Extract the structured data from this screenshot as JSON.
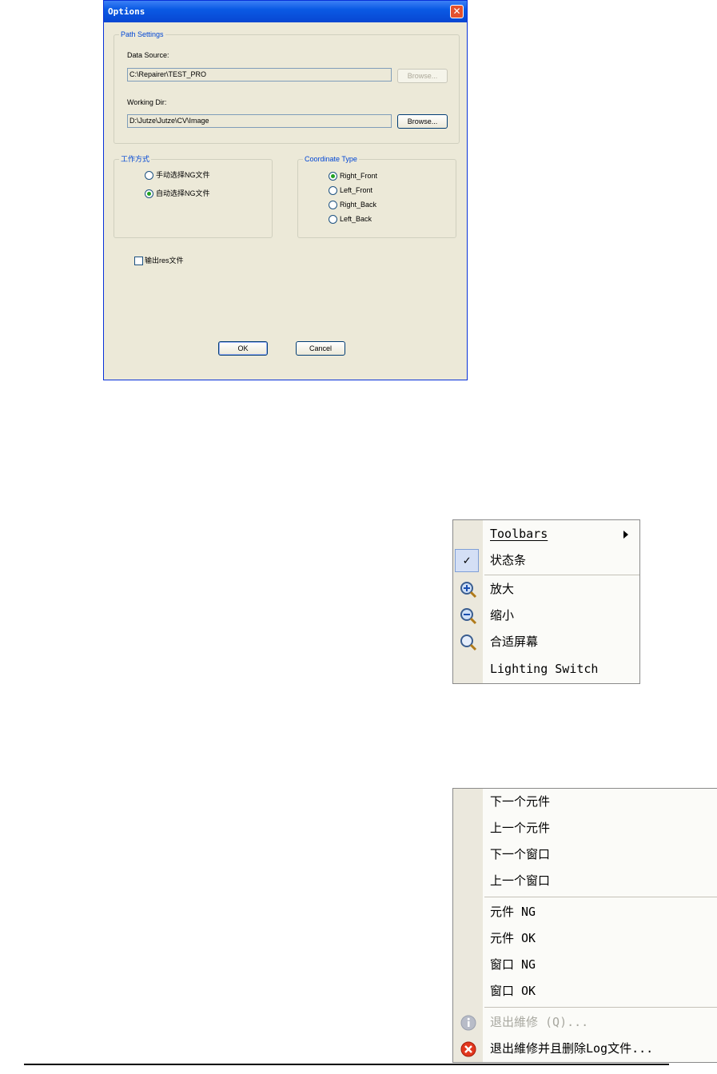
{
  "dialog": {
    "title": "Options",
    "close_glyph": "✕",
    "path_settings": {
      "group_title": "Path Settings",
      "data_source_label": "Data Source:",
      "data_source_value": "C:\\Repairer\\TEST_PRO",
      "data_source_browse": "Browse...",
      "working_dir_label": "Working Dir:",
      "working_dir_value": "D:\\Jutze\\Jutze\\CV\\Image",
      "working_dir_browse": "Browse..."
    },
    "work_mode": {
      "group_title": "工作方式",
      "options": [
        {
          "label": "手动选择NG文件",
          "checked": false
        },
        {
          "label": "自动选择NG文件",
          "checked": true
        }
      ]
    },
    "coordinate_type": {
      "group_title": "Coordinate Type",
      "options": [
        {
          "label": "Right_Front",
          "checked": true
        },
        {
          "label": "Left_Front",
          "checked": false
        },
        {
          "label": "Right_Back",
          "checked": false
        },
        {
          "label": "Left_Back",
          "checked": false
        }
      ]
    },
    "output_checkbox": {
      "label": "输出res文件",
      "checked": false
    },
    "ok_label": "OK",
    "cancel_label": "Cancel"
  },
  "view_menu": {
    "items": [
      {
        "label": "Toolbars",
        "icon": "",
        "submenu": true
      },
      {
        "label": "状态条",
        "icon": "check-icon",
        "checked": true
      },
      {
        "label": "放大",
        "icon": "zoom-in-icon"
      },
      {
        "label": "缩小",
        "icon": "zoom-out-icon"
      },
      {
        "label": "合适屏幕",
        "icon": "zoom-fit-icon"
      },
      {
        "label": "Lighting Switch",
        "icon": ""
      }
    ]
  },
  "nav_menu": {
    "items": [
      {
        "label": "下一个元件"
      },
      {
        "label": "上一个元件"
      },
      {
        "label": "下一个窗口"
      },
      {
        "label": "上一个窗口"
      },
      {
        "label": "元件 NG"
      },
      {
        "label": "元件 OK"
      },
      {
        "label": "窗口 NG"
      },
      {
        "label": "窗口 OK"
      },
      {
        "label": "退出維修 (Q)...",
        "icon": "info-icon",
        "disabled": true
      },
      {
        "label": "退出維修并且删除Log文件...",
        "icon": "close-red-icon"
      }
    ]
  },
  "colors": {
    "title_bar": "#0a5ae4",
    "dialog_bg": "#ece9d8",
    "group_title": "#0046d5",
    "radio_dot": "#21a121",
    "close_button": "#e4512e"
  }
}
